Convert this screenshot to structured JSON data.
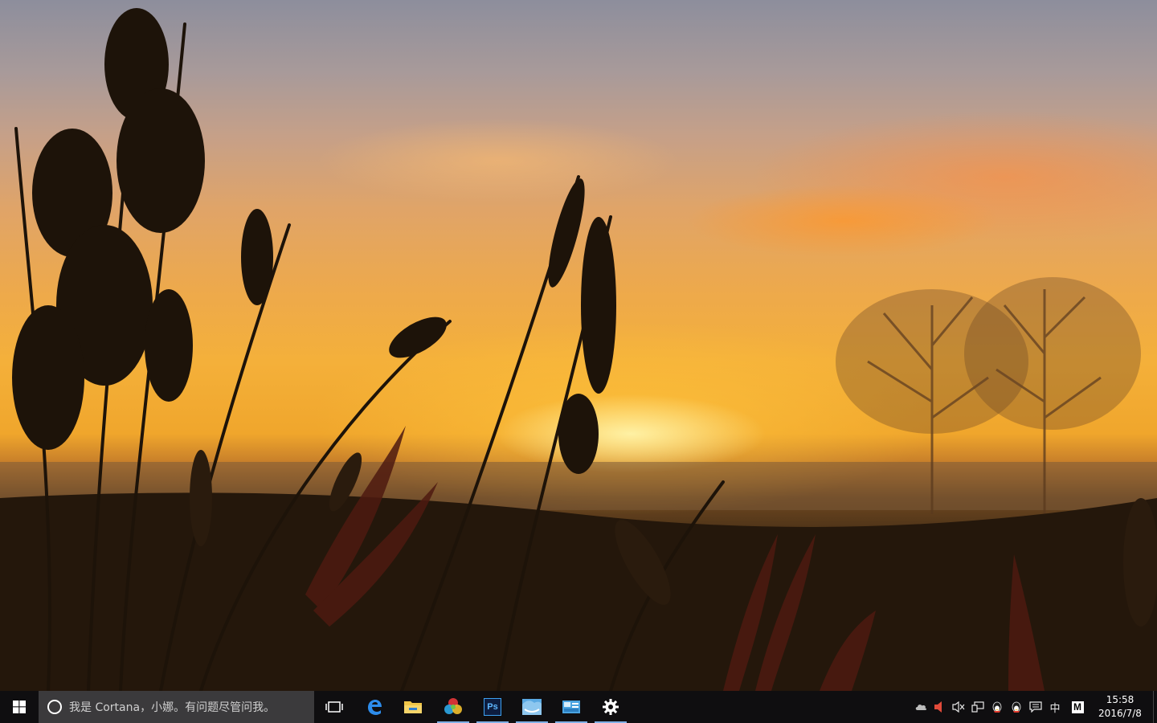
{
  "taskbar": {
    "search_placeholder": "我是 Cortana，小娜。有问题尽管问我。",
    "apps": [
      {
        "name": "task-view",
        "active": false
      },
      {
        "name": "edge",
        "active": false
      },
      {
        "name": "file-explorer",
        "active": false
      },
      {
        "name": "picture-viewer",
        "active": true
      },
      {
        "name": "photoshop",
        "active": true,
        "label": "Ps"
      },
      {
        "name": "weather-app",
        "active": true
      },
      {
        "name": "network-app",
        "active": true
      },
      {
        "name": "settings",
        "active": true
      }
    ],
    "tray": {
      "ime_label": "中",
      "m_label": "M"
    },
    "clock": {
      "time": "15:58",
      "date": "2016/7/8"
    }
  },
  "colors": {
    "taskbar_bg": "#0f0e10",
    "search_bg": "#3b3a3c",
    "accent": "#7fb0e6"
  }
}
